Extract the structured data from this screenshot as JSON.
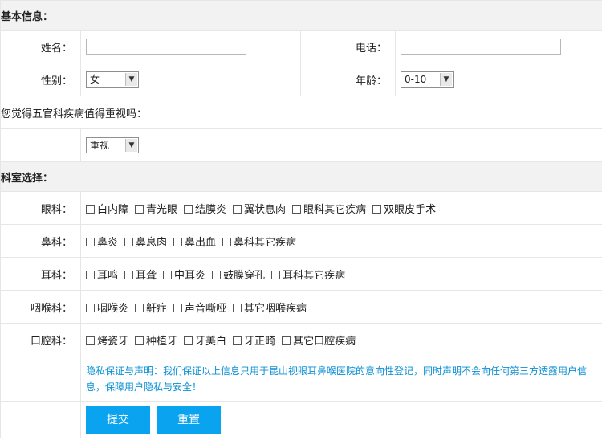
{
  "basic_info": {
    "heading": "基本信息：",
    "name_label": "姓名：",
    "name_value": "",
    "phone_label": "电话：",
    "phone_value": "",
    "gender_label": "性别：",
    "gender_selected": "女",
    "age_label": "年龄：",
    "age_selected": "0-10"
  },
  "importance": {
    "question": "您觉得五官科疾病值得重视吗：",
    "selected": "重视"
  },
  "departments": {
    "heading": "科室选择：",
    "groups": [
      {
        "label": "眼科：",
        "options": [
          "白内障",
          "青光眼",
          "结膜炎",
          "翼状息肉",
          "眼科其它疾病",
          "双眼皮手术"
        ]
      },
      {
        "label": "鼻科：",
        "options": [
          "鼻炎",
          "鼻息肉",
          "鼻出血",
          "鼻科其它疾病"
        ]
      },
      {
        "label": "耳科：",
        "options": [
          "耳鸣",
          "耳聋",
          "中耳炎",
          "鼓膜穿孔",
          "耳科其它疾病"
        ]
      },
      {
        "label": "咽喉科：",
        "options": [
          "咽喉炎",
          "鼾症",
          "声音嘶哑",
          "其它咽喉疾病"
        ]
      },
      {
        "label": "口腔科：",
        "options": [
          "烤瓷牙",
          "种植牙",
          "牙美白",
          "牙正畸",
          "其它口腔疾病"
        ]
      }
    ]
  },
  "privacy_notice": "隐私保证与声明：我们保证以上信息只用于昆山视眼耳鼻喉医院的意向性登记，同时声明不会向任何第三方透露用户信息，保障用户隐私与安全！",
  "buttons": {
    "submit": "提交",
    "reset": "重置"
  },
  "colors": {
    "accent": "#0aa3f0",
    "notice_text": "#0a8fd4",
    "section_bg": "#f2f2f2"
  }
}
